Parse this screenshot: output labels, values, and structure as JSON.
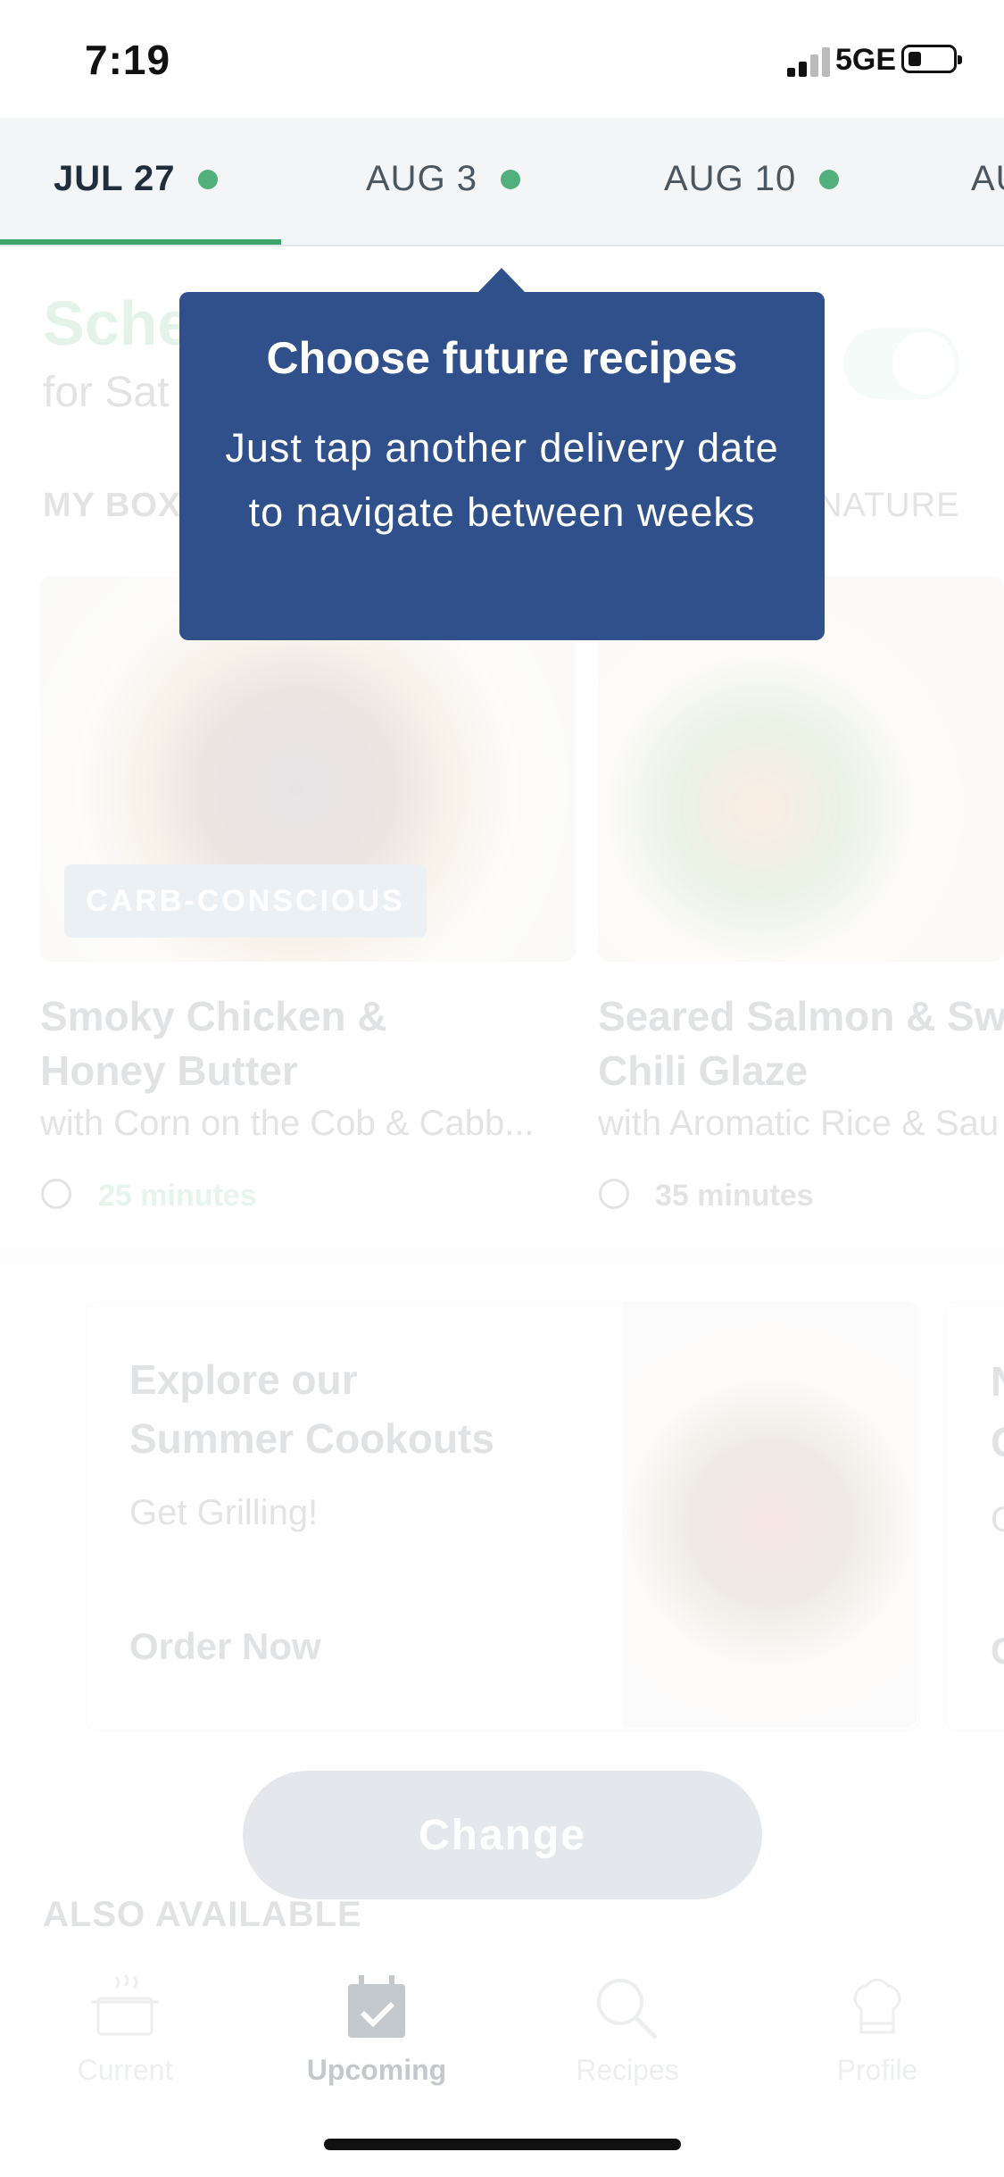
{
  "status_bar": {
    "time": "7:19",
    "network": "5GE"
  },
  "date_tabs": [
    {
      "label": "JUL 27",
      "selected": true
    },
    {
      "label": "AUG 3",
      "selected": false
    },
    {
      "label": "AUG 10",
      "selected": false
    },
    {
      "label": "AU",
      "selected": false
    }
  ],
  "schedule": {
    "title": "Sche",
    "subtitle": "for Sat"
  },
  "section_tabs": {
    "my_box": "MY BOX",
    "signature": "NATURE"
  },
  "recipes": [
    {
      "title_line1": "Smoky Chicken &",
      "title_line2": "Honey Butter",
      "subtitle": "with Corn on the Cob & Cabb...",
      "time": "25 minutes",
      "badge": "CARB-CONSCIOUS"
    },
    {
      "title_line1": "Seared Salmon & Swe",
      "title_line2": "Chili Glaze",
      "subtitle": "with Aromatic Rice & Sau",
      "time": "35 minutes"
    }
  ],
  "promo": {
    "title_line1": "Explore our",
    "title_line2": "Summer Cookouts",
    "subtitle": "Get Grilling!",
    "cta": "Order Now"
  },
  "promo_next": {
    "a": "N",
    "b": "C",
    "c": "G",
    "d": "C"
  },
  "change_button": "Change",
  "also_available": "ALSO AVAILABLE",
  "nav": {
    "current": "Current",
    "upcoming": "Upcoming",
    "recipes": "Recipes",
    "profile": "Profile"
  },
  "tooltip": {
    "title": "Choose future recipes",
    "body": "Just tap another delivery date to navigate between weeks"
  },
  "colors": {
    "accent_green": "#3aa46a",
    "tooltip_blue": "#30508c",
    "badge_blue": "#6c8fb5"
  }
}
